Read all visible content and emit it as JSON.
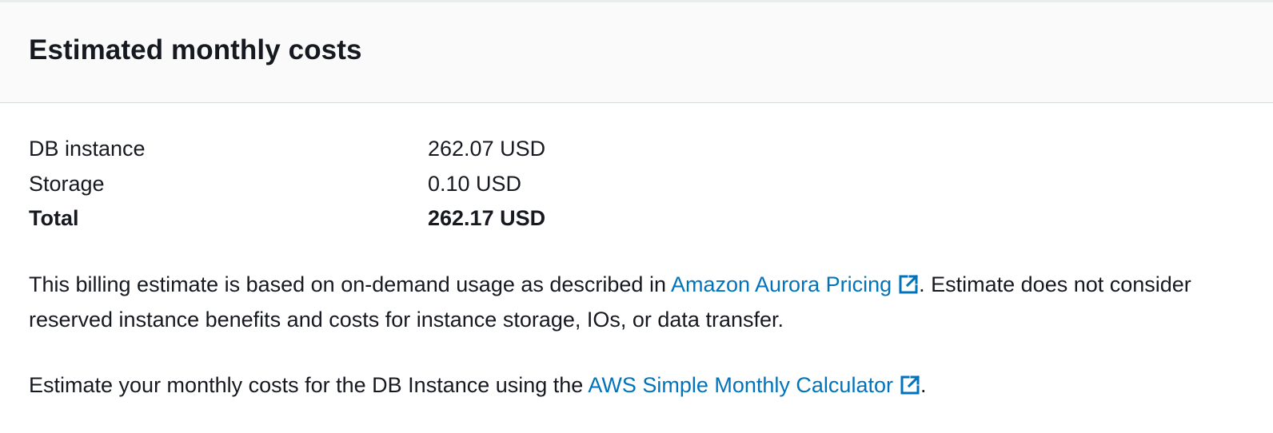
{
  "panel": {
    "title": "Estimated monthly costs"
  },
  "costs": {
    "rows": [
      {
        "label": "DB instance",
        "value": "262.07 USD"
      },
      {
        "label": "Storage",
        "value": "0.10 USD"
      }
    ],
    "total": {
      "label": "Total",
      "value": "262.17 USD"
    }
  },
  "notes": {
    "billing": {
      "before": "This billing estimate is based on on-demand usage as described in ",
      "link_text": "Amazon Aurora Pricing",
      "after": ". Estimate does not consider reserved instance benefits and costs for instance storage, IOs, or data transfer."
    },
    "calculator": {
      "before": "Estimate your monthly costs for the DB Instance using the ",
      "link_text": "AWS Simple Monthly Calculator",
      "after": "."
    }
  },
  "icons": {
    "external_link": "external-link-icon"
  },
  "colors": {
    "link": "#0073bb",
    "text": "#16191f",
    "header_bg": "#fafafa",
    "divider": "#d5dbdb"
  }
}
